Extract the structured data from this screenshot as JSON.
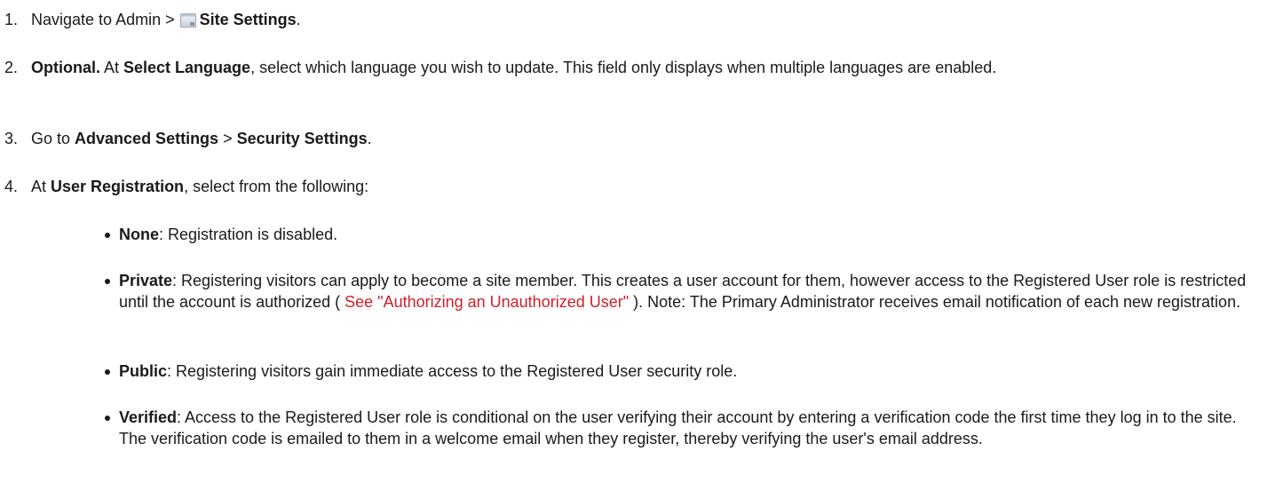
{
  "steps": [
    {
      "num": "1.",
      "pre": "Navigate to Admin > ",
      "icon": "site-settings-icon",
      "bold": "Site Settings",
      "post": "."
    },
    {
      "num": "2.",
      "b1": "Optional.",
      "t1": " At ",
      "b2": "Select Language",
      "t2": ", select which language you wish to update. This field only displays when multiple languages are enabled."
    },
    {
      "num": "3.",
      "t1": "Go to ",
      "b1": "Advanced Settings",
      "t2": " > ",
      "b2": "Security Settings",
      "t3": "."
    },
    {
      "num": "4.",
      "t1": "At ",
      "b1": "User Registration",
      "t2": ", select from the following:"
    }
  ],
  "options": [
    {
      "name": "None",
      "desc": ": Registration is disabled."
    },
    {
      "name": "Private",
      "desc_a": ": Registering visitors can apply to become a site member. This creates a user account for them, however access to the Registered User role is restricted until the account is authorized ( ",
      "link": "See \"Authorizing an Unauthorized User\"",
      "desc_b": " ). Note: The Primary Administrator receives email notification of each new registration."
    },
    {
      "name": "Public",
      "desc": ": Registering visitors gain immediate access to the Registered User security role."
    },
    {
      "name": "Verified",
      "desc": ": Access to the Registered User role is conditional on the user verifying their account by entering a verification code the first time they log in to the site. The verification code is emailed to them in a welcome email when they register, thereby verifying the user's email address."
    }
  ],
  "colors": {
    "text": "#1a1a1a",
    "link": "#d0202a"
  }
}
